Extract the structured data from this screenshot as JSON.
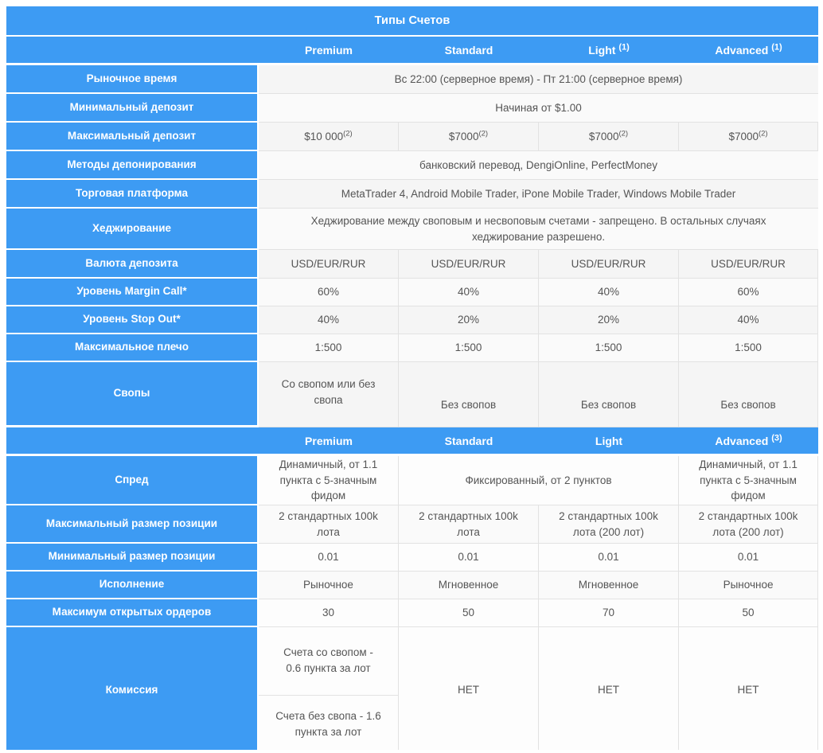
{
  "table": {
    "title": "Типы Счетов",
    "colors": {
      "header_blue": "#3d9bf3",
      "cell_gray": "#f5f5f5",
      "text_gray": "#555555",
      "border": "#e2e2e2"
    },
    "columns_primary": [
      {
        "label": "Premium",
        "note": ""
      },
      {
        "label": "Standard",
        "note": ""
      },
      {
        "label": "Light",
        "note": "(1)"
      },
      {
        "label": "Advanced",
        "note": "(1)"
      }
    ],
    "columns_secondary": [
      {
        "label": "Premium",
        "note": ""
      },
      {
        "label": "Standard",
        "note": ""
      },
      {
        "label": "Light",
        "note": ""
      },
      {
        "label": "Advanced",
        "note": "(3)"
      }
    ],
    "section_one": [
      {
        "label": "Рыночное время",
        "span": "all",
        "values": [
          "Вс 22:00 (серверное время) - Пт 21:00 (серверное время)"
        ]
      },
      {
        "label": "Минимальный депозит",
        "span": "all",
        "values": [
          "Начиная от $1.00"
        ]
      },
      {
        "label": "Максимальный депозит",
        "span": "each",
        "values": [
          "$10 000",
          "$7000",
          "$7000",
          "$7000"
        ],
        "notes": [
          "(2)",
          "(2)",
          "(2)",
          "(2)"
        ]
      },
      {
        "label": "Методы депонирования",
        "span": "all",
        "values": [
          "банковский перевод, DengiOnline, PerfectMoney"
        ]
      },
      {
        "label": "Торговая платформа",
        "span": "all",
        "values": [
          "MetaTrader 4, Android Mobile Trader, iPone Mobile Trader, Windows Mobile Trader"
        ]
      },
      {
        "label": "Хеджирование",
        "span": "all",
        "values": [
          "Хеджирование между своповым и несвоповым счетами - запрещено. В остальных случаях хеджирование разрешено."
        ]
      },
      {
        "label": "Валюта депозита",
        "span": "each",
        "values": [
          "USD/EUR/RUR",
          "USD/EUR/RUR",
          "USD/EUR/RUR",
          "USD/EUR/RUR"
        ]
      },
      {
        "label": "Уровень Margin Call*",
        "span": "each",
        "values": [
          "60%",
          "40%",
          "40%",
          "60%"
        ]
      },
      {
        "label": "Уровень Stop Out*",
        "span": "each",
        "values": [
          "40%",
          "20%",
          "20%",
          "40%"
        ]
      },
      {
        "label": "Максимальное плечо",
        "span": "each",
        "values": [
          "1:500",
          "1:500",
          "1:500",
          "1:500"
        ]
      },
      {
        "label": "Свопы",
        "span": "each",
        "values": [
          "Со свопом или без свопа",
          "Без свопов",
          "Без свопов",
          "Без свопов"
        ]
      }
    ],
    "section_two": [
      {
        "label": "Спред",
        "span": "merge_middle",
        "values": [
          "Динамичный, от 1.1 пункта с 5-значным фидом",
          "Фиксированный, от 2 пунктов",
          "Динамичный, от 1.1 пункта с 5-значным фидом"
        ]
      },
      {
        "label": "Максимальный размер позиции",
        "span": "each",
        "values": [
          "2 стандартных 100k лота",
          "2 стандартных 100k лота",
          "2 стандартных 100k лота (200 лот)",
          "2 стандартных 100k лота (200 лот)"
        ]
      },
      {
        "label": "Минимальный размер позиции",
        "span": "each",
        "values": [
          "0.01",
          "0.01",
          "0.01",
          "0.01"
        ]
      },
      {
        "label": "Исполнение",
        "span": "each",
        "values": [
          "Рыночное",
          "Мгновенное",
          "Мгновенное",
          "Рыночное"
        ]
      },
      {
        "label": "Максимум открытых ордеров",
        "span": "each",
        "values": [
          "30",
          "50",
          "70",
          "50"
        ]
      },
      {
        "label": "Комиссия",
        "span": "split_first",
        "values_split": [
          "Счета со свопом - 0.6 пункта за лот",
          "Счета без свопа - 1.6 пункта за лот"
        ],
        "values": [
          "НЕТ",
          "НЕТ",
          "НЕТ"
        ]
      }
    ]
  }
}
